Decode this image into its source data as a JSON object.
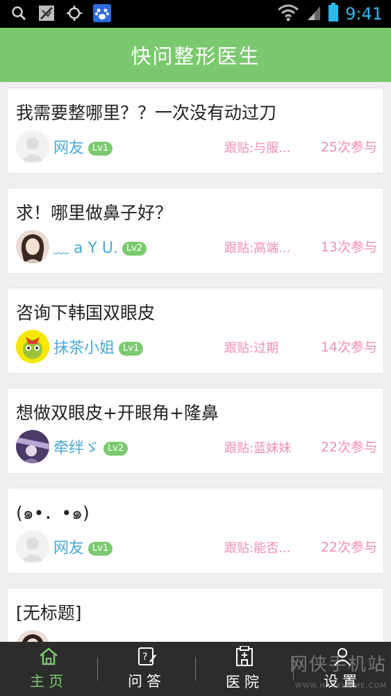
{
  "status_bar": {
    "time": "9:41"
  },
  "header": {
    "title": "快问整形医生"
  },
  "posts": [
    {
      "title": "我需要整哪里？？一次没有动过刀",
      "user": "网友",
      "level": "Lv1",
      "follow": "跟贴:与服...",
      "count": "25次参与"
    },
    {
      "title": "求！哪里做鼻子好？",
      "user": "﹏ a Y U.",
      "level": "Lv2",
      "follow": "跟贴:高端...",
      "count": "13次参与"
    },
    {
      "title": "咨询下韩国双眼皮",
      "user": "抹茶小姐",
      "level": "Lv1",
      "follow": "跟贴:过期",
      "count": "14次参与"
    },
    {
      "title": "想做双眼皮+开眼角+隆鼻",
      "user": "牵绊ゞ",
      "level": "Lv2",
      "follow": "跟贴:蓝妹妹",
      "count": "22次参与"
    },
    {
      "title": "(๑•．•๑)",
      "user": "网友",
      "level": "Lv1",
      "follow": "跟贴:能否...",
      "count": "22次参与"
    },
    {
      "title": "[无标题]",
      "user": "",
      "level": "",
      "follow": "",
      "count": ""
    }
  ],
  "tabs": [
    {
      "label": "主页",
      "icon": "home-icon",
      "active": true
    },
    {
      "label": "问答",
      "icon": "qa-edit-icon",
      "active": false
    },
    {
      "label": "医院",
      "icon": "hospital-icon",
      "active": false
    },
    {
      "label": "设置",
      "icon": "settings-user-icon",
      "active": false
    }
  ],
  "watermark": {
    "text": "网侠手机站",
    "sub": "WWW.HACKHOME.COM"
  },
  "colors": {
    "accent": "#7bc96f",
    "link": "#4aa8d8",
    "pink": "#f08db0"
  }
}
